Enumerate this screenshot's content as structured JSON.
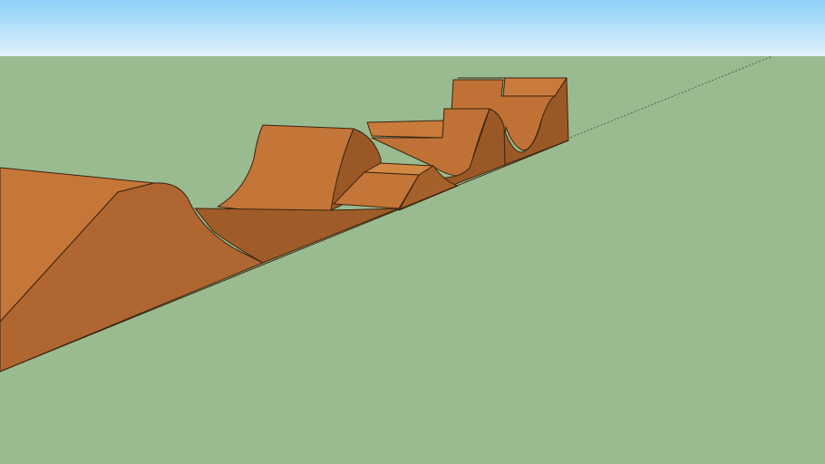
{
  "scene": {
    "colors": {
      "sky_top": "#8ccff8",
      "sky_horizon": "#e2f3fc",
      "ground": "#9aba8f",
      "wood_light": "#c97b3c",
      "wood_mid": "#b56a2f",
      "wood_dark": "#8f5020",
      "edge": "#3a2410"
    }
  }
}
